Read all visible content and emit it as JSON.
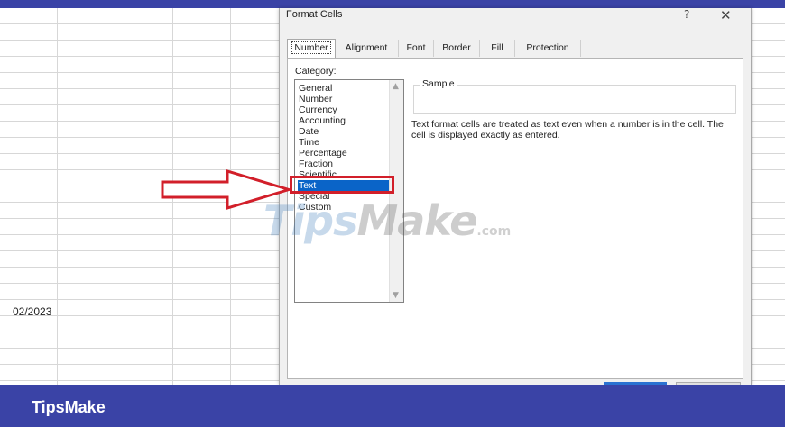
{
  "spreadsheet": {
    "visible_cell_value": "02/2023"
  },
  "dialog": {
    "title": "Format Cells",
    "help_label": "?",
    "close_label": "✕",
    "tabs": [
      {
        "label": "Number",
        "active": true
      },
      {
        "label": "Alignment",
        "active": false
      },
      {
        "label": "Font",
        "active": false
      },
      {
        "label": "Border",
        "active": false
      },
      {
        "label": "Fill",
        "active": false
      },
      {
        "label": "Protection",
        "active": false
      }
    ],
    "category_label": "Category:",
    "categories": [
      "General",
      "Number",
      "Currency",
      "Accounting",
      "Date",
      "Time",
      "Percentage",
      "Fraction",
      "Scientific",
      "Text",
      "Special",
      "Custom"
    ],
    "selected_category": "Text",
    "sample_label": "Sample",
    "description": "Text format cells are treated as text even when a number is in the cell. The cell is displayed exactly as entered."
  },
  "overlay": {
    "highlight_color": "#d21f2a",
    "arrow_icon": "right-arrow-outline"
  },
  "watermark": {
    "part1": "Tips",
    "part2": "Make",
    "part3": ".com"
  },
  "footer": {
    "brand": "TipsMake",
    "background": "#3a43a6"
  }
}
